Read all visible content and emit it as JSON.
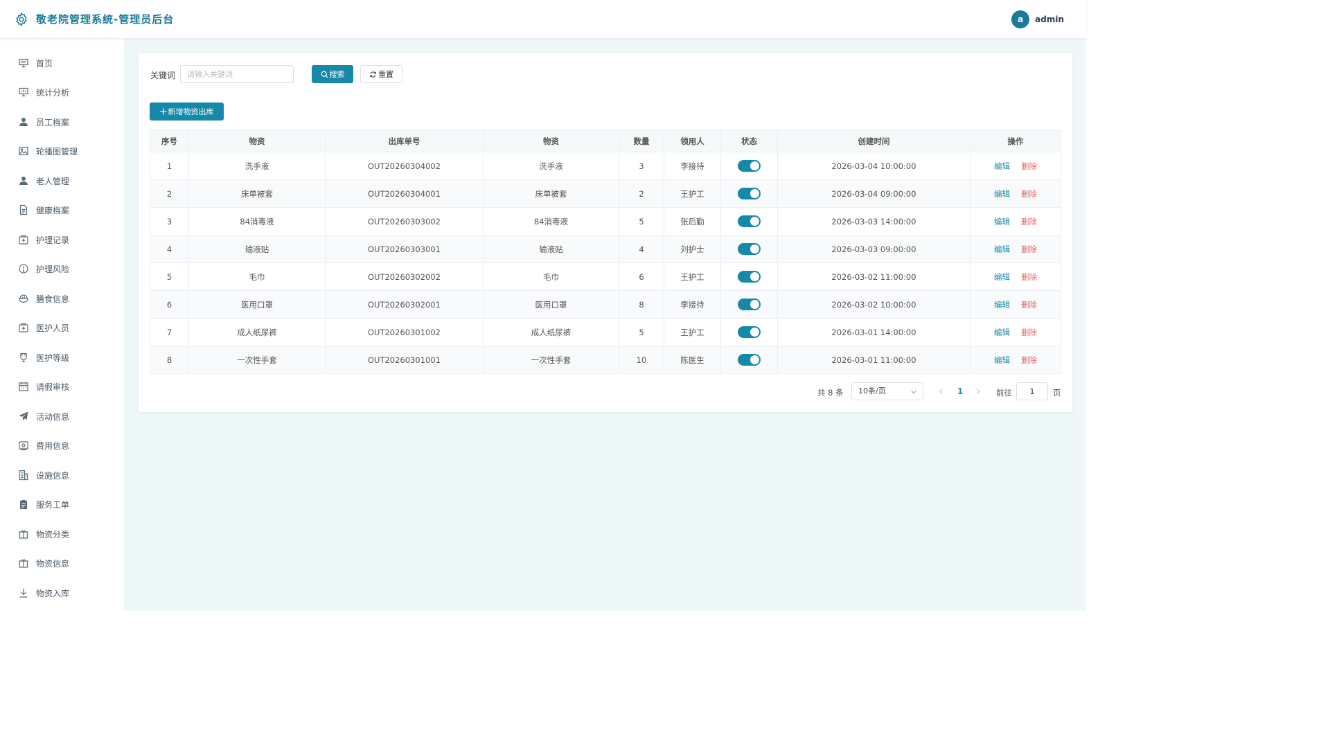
{
  "header": {
    "title": "敬老院管理系统-管理员后台",
    "avatar_letter": "a",
    "username": "admin"
  },
  "sidebar": {
    "items": [
      {
        "label": "首页",
        "icon": "home-chart-icon"
      },
      {
        "label": "统计分析",
        "icon": "chart-icon"
      },
      {
        "label": "员工档案",
        "icon": "user-icon"
      },
      {
        "label": "轮播图管理",
        "icon": "image-icon"
      },
      {
        "label": "老人管理",
        "icon": "user-icon"
      },
      {
        "label": "健康档案",
        "icon": "document-icon"
      },
      {
        "label": "护理记录",
        "icon": "medical-box-icon"
      },
      {
        "label": "护理风险",
        "icon": "warning-circle-icon"
      },
      {
        "label": "膳食信息",
        "icon": "food-bowl-icon"
      },
      {
        "label": "医护人员",
        "icon": "medical-box-icon"
      },
      {
        "label": "医护等级",
        "icon": "cup-icon"
      },
      {
        "label": "请假审核",
        "icon": "calendar-icon"
      },
      {
        "label": "活动信息",
        "icon": "send-icon"
      },
      {
        "label": "费用信息",
        "icon": "wallet-icon"
      },
      {
        "label": "设施信息",
        "icon": "building-icon"
      },
      {
        "label": "服务工单",
        "icon": "clipboard-icon"
      },
      {
        "label": "物资分类",
        "icon": "box-icon"
      },
      {
        "label": "物资信息",
        "icon": "box-icon"
      },
      {
        "label": "物资入库",
        "icon": "download-icon"
      }
    ]
  },
  "search": {
    "label": "关键词",
    "placeholder": "请输入关键词",
    "search_button": "搜索",
    "reset_button": "重置"
  },
  "toolbar": {
    "add_button": "新增物资出库"
  },
  "table": {
    "columns": [
      "序号",
      "物资",
      "出库单号",
      "物资",
      "数量",
      "领用人",
      "状态",
      "创建时间",
      "操作"
    ],
    "edit_label": "编辑",
    "delete_label": "删除",
    "rows": [
      {
        "index": "1",
        "item": "洗手液",
        "order_no": "OUT20260304002",
        "item2": "洗手液",
        "qty": "3",
        "recipient": "李接待",
        "status": true,
        "created": "2026-03-04 10:00:00"
      },
      {
        "index": "2",
        "item": "床单被套",
        "order_no": "OUT20260304001",
        "item2": "床单被套",
        "qty": "2",
        "recipient": "王护工",
        "status": true,
        "created": "2026-03-04 09:00:00"
      },
      {
        "index": "3",
        "item": "84消毒液",
        "order_no": "OUT20260303002",
        "item2": "84消毒液",
        "qty": "5",
        "recipient": "张后勤",
        "status": true,
        "created": "2026-03-03 14:00:00"
      },
      {
        "index": "4",
        "item": "输液贴",
        "order_no": "OUT20260303001",
        "item2": "输液贴",
        "qty": "4",
        "recipient": "刘护士",
        "status": true,
        "created": "2026-03-03 09:00:00"
      },
      {
        "index": "5",
        "item": "毛巾",
        "order_no": "OUT20260302002",
        "item2": "毛巾",
        "qty": "6",
        "recipient": "王护工",
        "status": true,
        "created": "2026-03-02 11:00:00"
      },
      {
        "index": "6",
        "item": "医用口罩",
        "order_no": "OUT20260302001",
        "item2": "医用口罩",
        "qty": "8",
        "recipient": "李接待",
        "status": true,
        "created": "2026-03-02 10:00:00"
      },
      {
        "index": "7",
        "item": "成人纸尿裤",
        "order_no": "OUT20260301002",
        "item2": "成人纸尿裤",
        "qty": "5",
        "recipient": "王护工",
        "status": true,
        "created": "2026-03-01 14:00:00"
      },
      {
        "index": "8",
        "item": "一次性手套",
        "order_no": "OUT20260301001",
        "item2": "一次性手套",
        "qty": "10",
        "recipient": "陈医生",
        "status": true,
        "created": "2026-03-01 11:00:00"
      }
    ]
  },
  "pagination": {
    "total_text": "共 8 条",
    "page_size": "10条/页",
    "current_page": "1",
    "goto_label": "前往",
    "goto_value": "1",
    "page_suffix": "页"
  },
  "colors": {
    "primary": "#1789a8",
    "danger": "#e26a6a",
    "background": "#eef8f8"
  }
}
